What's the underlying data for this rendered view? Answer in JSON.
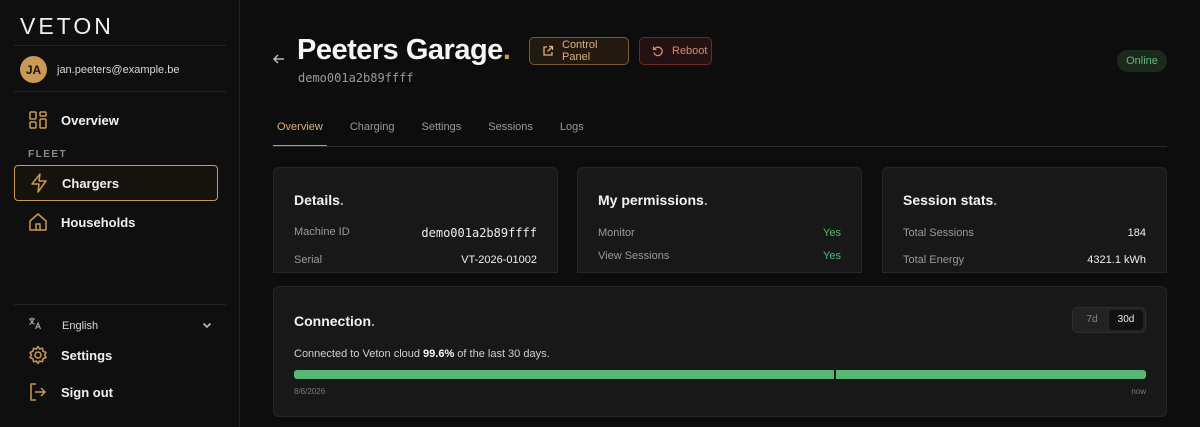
{
  "app": {
    "logo": "VETON"
  },
  "user": {
    "initials": "JA",
    "email": "jan.peeters@example.be"
  },
  "sidebar": {
    "overview": "Overview",
    "section": "FLEET",
    "chargers": "Chargers",
    "households": "Households",
    "language": "English",
    "settings": "Settings",
    "signout": "Sign out"
  },
  "header": {
    "title": "Peeters Garage",
    "title_dot": ".",
    "machine_id": "demo001a2b89ffff",
    "control_panel": "Control Panel",
    "reboot": "Reboot",
    "status": "Online"
  },
  "tabs": [
    "Overview",
    "Charging",
    "Settings",
    "Sessions",
    "Logs"
  ],
  "details": {
    "title": "Details",
    "rows": [
      {
        "k": "Machine ID",
        "v": "demo001a2b89ffff"
      },
      {
        "k": "Serial",
        "v": "VT-2026-01002"
      }
    ]
  },
  "permissions": {
    "title": "My permissions",
    "rows": [
      {
        "k": "Monitor",
        "v": "Yes"
      },
      {
        "k": "View Sessions",
        "v": "Yes"
      }
    ]
  },
  "stats": {
    "title": "Session stats",
    "rows": [
      {
        "k": "Total Sessions",
        "v": "184"
      },
      {
        "k": "Total Energy",
        "v": "4321.1 kWh"
      }
    ]
  },
  "connection": {
    "title": "Connection",
    "range_7d": "7d",
    "range_30d": "30d",
    "text_prefix": "Connected to Veton cloud ",
    "uptime": "99.6%",
    "text_suffix": " of the last 30 days.",
    "uptime_fraction": 0.996,
    "start_label": "8/6/2026",
    "end_label": "now",
    "colors": {
      "up": "#56b874",
      "accent": "#c89a55"
    }
  }
}
